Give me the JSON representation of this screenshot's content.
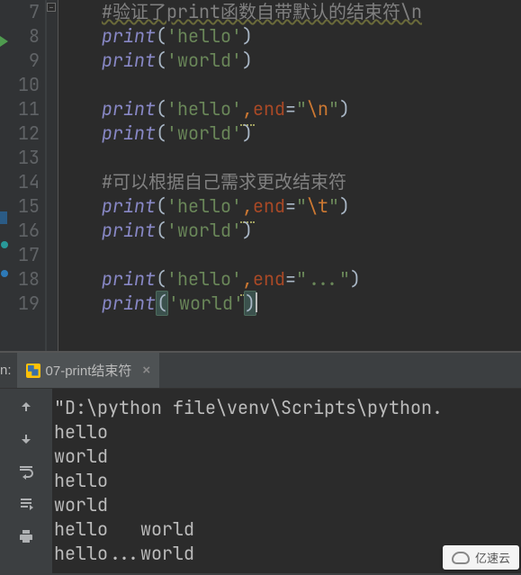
{
  "code": {
    "lines": [
      {
        "num": "7",
        "type": "comment",
        "text": "#验证了print函数自带默认的结束符\\n"
      },
      {
        "num": "8",
        "type": "print",
        "call": "print",
        "open": "(",
        "arg": "'hello'",
        "close": ")"
      },
      {
        "num": "9",
        "type": "print",
        "call": "print",
        "open": "(",
        "arg": "'world'",
        "close": ")"
      },
      {
        "num": "10",
        "type": "blank",
        "text": ""
      },
      {
        "num": "11",
        "type": "print_end",
        "call": "print",
        "open": "(",
        "arg": "'hello'",
        "comma": ",",
        "end_kw": "end",
        "eq": "=",
        "end_val": "\"\\n\"",
        "close": ")"
      },
      {
        "num": "12",
        "type": "print",
        "call": "print",
        "open": "(",
        "arg": "'world'",
        "close": ")"
      },
      {
        "num": "13",
        "type": "blank",
        "text": ""
      },
      {
        "num": "14",
        "type": "comment",
        "text": "#可以根据自己需求更改结束符"
      },
      {
        "num": "15",
        "type": "print_end",
        "call": "print",
        "open": "(",
        "arg": "'hello'",
        "comma": ",",
        "end_kw": "end",
        "eq": "=",
        "end_val": "\"\\t\"",
        "close": ")"
      },
      {
        "num": "16",
        "type": "print",
        "call": "print",
        "open": "(",
        "arg": "'world'",
        "close": ")"
      },
      {
        "num": "17",
        "type": "blank",
        "text": ""
      },
      {
        "num": "18",
        "type": "print_end",
        "call": "print",
        "open": "(",
        "arg": "'hello'",
        "comma": ",",
        "end_kw": "end",
        "eq": "=",
        "end_val": "\"...\"",
        "close": ")"
      },
      {
        "num": "19",
        "type": "print_caret",
        "call": "print",
        "open": "(",
        "arg": "'world'",
        "close": ")"
      }
    ]
  },
  "run": {
    "panel_label": "n:",
    "tab_title": "07-print结束符",
    "tab_close": "×"
  },
  "console_output": [
    "\"D:\\python file\\venv\\Scripts\\python.",
    "hello",
    "world",
    "hello",
    "world",
    "hello   world",
    "hello...world"
  ],
  "toolbar_icons": {
    "up": "arrow-up-icon",
    "down": "arrow-down-icon",
    "wrap": "soft-wrap-icon",
    "scroll": "scroll-to-end-icon",
    "print": "print-icon"
  },
  "watermark_text": "亿速云",
  "colors": {
    "background": "#2b2b2b",
    "gutter": "#313335",
    "keyword": "#cc7832",
    "string": "#6a8759",
    "comment": "#808080",
    "builtin": "#8888c6"
  }
}
